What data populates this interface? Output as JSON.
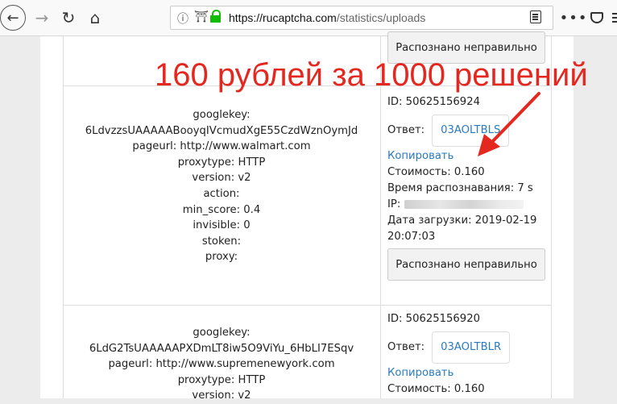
{
  "browser": {
    "url_host": "https://rucaptcha.com",
    "url_path": "/statistics/uploads",
    "icons": [
      "back-arrow-icon",
      "forward-arrow-icon",
      "reload-icon",
      "home-icon",
      "info-icon",
      "shield-icon",
      "lock-icon",
      "reader-view-icon",
      "more-icon",
      "pocket-icon",
      "menu-icon"
    ]
  },
  "annotation": "160 рублей за 1000 решений",
  "colors": {
    "annotation": "#e4281f",
    "link": "#2a7ac0",
    "lock": "#12bc00"
  },
  "wrong_button_label": "Распознано неправильно",
  "rows": [
    {
      "params": [
        "googlekey:",
        "6LdvzzsUAAAAABooyqIVcmudXgE55CzdWznOymJd",
        "pageurl: http://www.walmart.com",
        "proxytype: HTTP",
        "version: v2",
        "action:",
        "min_score: 0.4",
        "invisible: 0",
        "stoken:",
        "proxy:"
      ],
      "id": "ID: 50625156924",
      "answer_label": "Ответ:",
      "answer": "03AOLTBLS",
      "copy": "Копировать",
      "cost": "Стоимость: 0.160",
      "time": "Время распознавания: 7 s",
      "ip_label": "IP:",
      "date_label": "Дата загрузки: 2019-02-19",
      "date_time": "20:07:03"
    },
    {
      "params": [
        "googlekey:",
        "6LdG2TsUAAAAAPXDmLT8iw5O9ViYu_6HbLI7ESqv",
        "pageurl: http://www.supremenewyork.com",
        "proxytype: HTTP",
        "version: v2"
      ],
      "id": "ID: 50625156920",
      "answer_label": "Ответ:",
      "answer": "03AOLTBLR",
      "copy": "Копировать",
      "cost": "Стоимость: 0.160"
    }
  ]
}
